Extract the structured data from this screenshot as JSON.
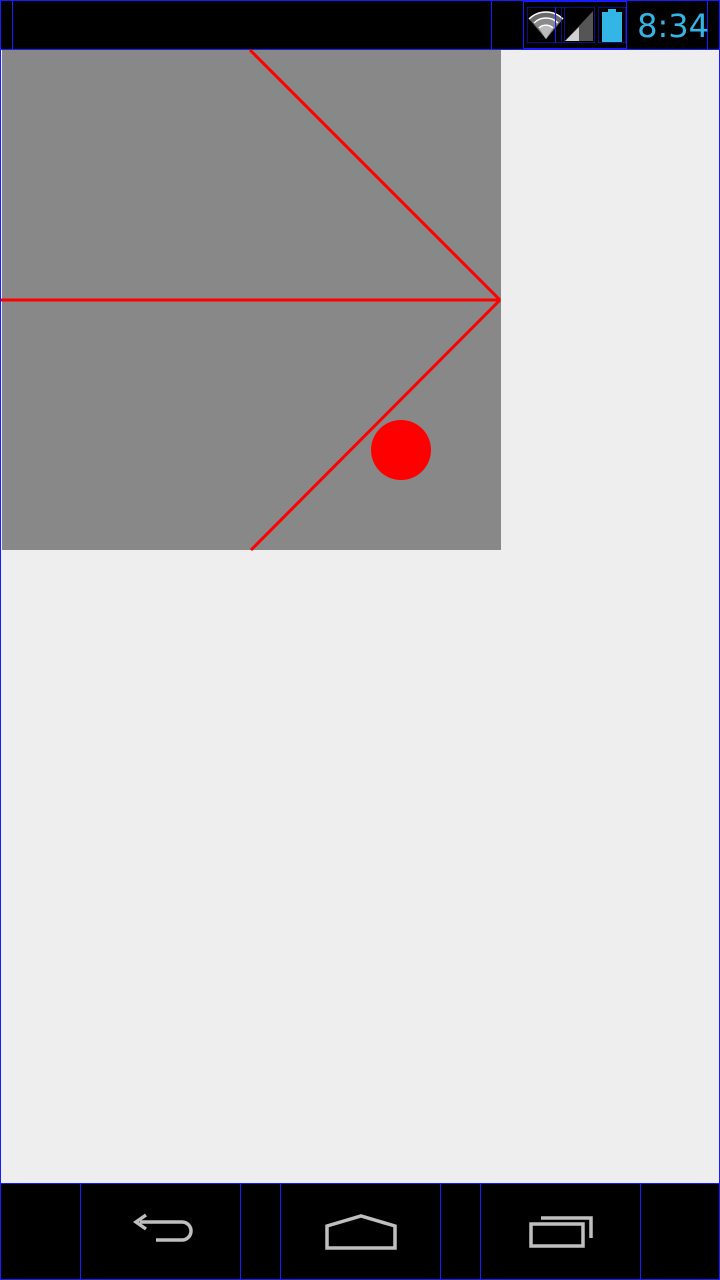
{
  "status_bar": {
    "time": "8:34",
    "icons": [
      "wifi-icon",
      "cell-signal-icon",
      "battery-icon"
    ],
    "accent_color": "#33b5e5"
  },
  "canvas": {
    "background_color": "#888888",
    "line_color": "#ff0000",
    "ball_color": "#ff0000"
  },
  "nav_bar": {
    "buttons": [
      "back-icon",
      "home-icon",
      "recent-apps-icon"
    ]
  }
}
